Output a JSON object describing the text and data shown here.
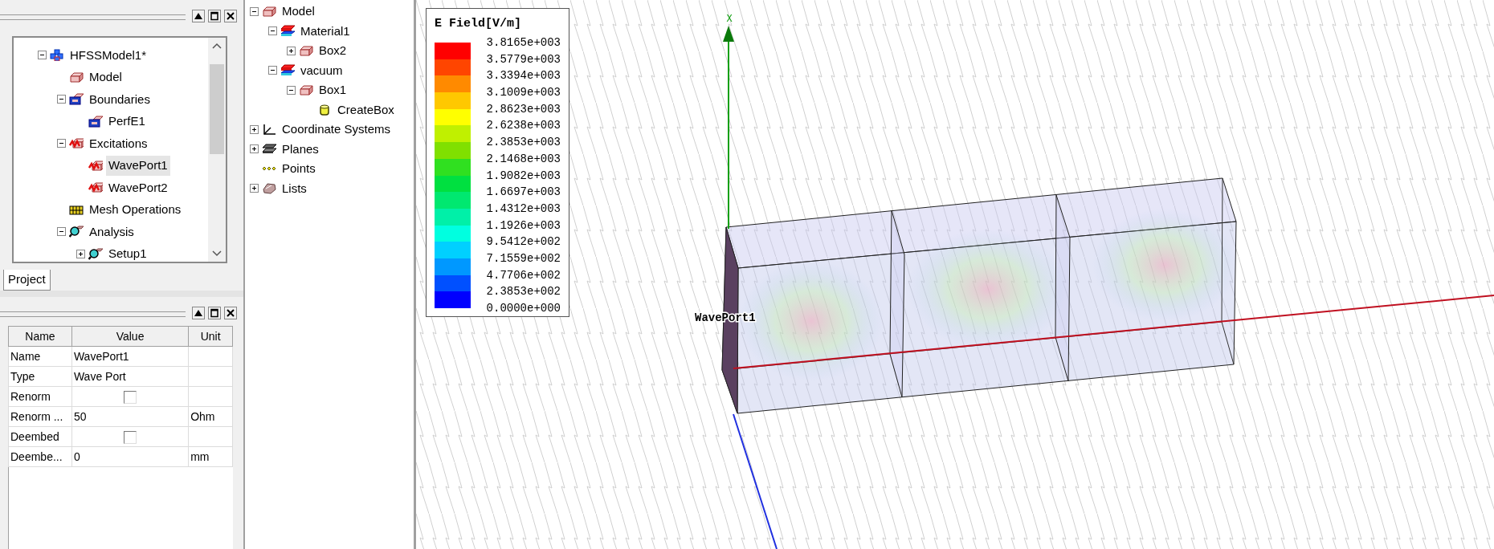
{
  "project_panel": {
    "tree": [
      {
        "label": "HFSSModel1*",
        "kind": "project",
        "expanded": true,
        "selected": false,
        "children": [
          {
            "label": "Model",
            "kind": "box",
            "selected": false
          },
          {
            "label": "Boundaries",
            "kind": "boundary",
            "expanded": true,
            "selected": false,
            "children": [
              {
                "label": "PerfE1",
                "kind": "boundary",
                "selected": false
              }
            ]
          },
          {
            "label": "Excitations",
            "kind": "excitation",
            "expanded": true,
            "selected": false,
            "children": [
              {
                "label": "WavePort1",
                "kind": "excitation",
                "selected": true
              },
              {
                "label": "WavePort2",
                "kind": "excitation",
                "selected": false
              }
            ]
          },
          {
            "label": "Mesh Operations",
            "kind": "mesh",
            "selected": false
          },
          {
            "label": "Analysis",
            "kind": "analysis",
            "expanded": true,
            "selected": false,
            "children": [
              {
                "label": "Setup1",
                "kind": "analysis",
                "expanded": false,
                "selected": false
              }
            ]
          }
        ]
      }
    ],
    "tabs": [
      {
        "label": "Project",
        "selected": true
      }
    ]
  },
  "properties_panel": {
    "columns": [
      "Name",
      "Value",
      "Unit"
    ],
    "rows": [
      {
        "kind": "text",
        "name": "Name",
        "value": "WavePort1"
      },
      {
        "kind": "text",
        "name": "Type",
        "value": "Wave Port"
      },
      {
        "kind": "checkbox",
        "name": "Renorm",
        "checked": false
      },
      {
        "kind": "text",
        "name": "Renorm ...",
        "value": "50",
        "unit": "Ohm"
      },
      {
        "kind": "checkbox",
        "name": "Deembed",
        "checked": false
      },
      {
        "kind": "text",
        "name": "Deembe...",
        "value": "0",
        "unit": "mm"
      }
    ]
  },
  "model_tree": [
    {
      "label": "Model",
      "kind": "box",
      "expanded": true,
      "selected": false,
      "children": [
        {
          "label": "Material1",
          "kind": "material",
          "expanded": true,
          "selected": false,
          "children": [
            {
              "label": "Box2",
              "kind": "box",
              "expanded": false,
              "selected": false
            }
          ]
        },
        {
          "label": "vacuum",
          "kind": "material",
          "expanded": true,
          "selected": false,
          "children": [
            {
              "label": "Box1",
              "kind": "box",
              "expanded": true,
              "selected": false,
              "children": [
                {
                  "label": "CreateBox",
                  "kind": "operation",
                  "selected": false
                }
              ]
            }
          ]
        }
      ]
    },
    {
      "label": "Coordinate Systems",
      "kind": "coords",
      "expanded": false,
      "selected": false
    },
    {
      "label": "Planes",
      "kind": "planes",
      "expanded": false,
      "selected": false
    },
    {
      "label": "Points",
      "kind": "points",
      "selected": false
    },
    {
      "label": "Lists",
      "kind": "lists",
      "expanded": false,
      "selected": false
    }
  ],
  "viewport": {
    "legend": {
      "title": "E Field[V/m]",
      "bands": [
        {
          "color": "#ff0000"
        },
        {
          "color": "#ff4500"
        },
        {
          "color": "#ff8a00"
        },
        {
          "color": "#ffc800"
        },
        {
          "color": "#ffff00"
        },
        {
          "color": "#c0f000"
        },
        {
          "color": "#80e000"
        },
        {
          "color": "#30e020"
        },
        {
          "color": "#00e040"
        },
        {
          "color": "#00e870"
        },
        {
          "color": "#00f0a8"
        },
        {
          "color": "#00ffe0"
        },
        {
          "color": "#00d0ff"
        },
        {
          "color": "#0098ff"
        },
        {
          "color": "#0050ff"
        },
        {
          "color": "#0000ff"
        }
      ],
      "labels": [
        "3.8165e+003",
        "3.5779e+003",
        "3.3394e+003",
        "3.1009e+003",
        "2.8623e+003",
        "2.6238e+003",
        "2.3853e+003",
        "2.1468e+003",
        "1.9082e+003",
        "1.6697e+003",
        "1.4312e+003",
        "1.1926e+003",
        "9.5412e+002",
        "7.1559e+002",
        "4.7706e+002",
        "2.3853e+002",
        "0.0000e+000"
      ]
    },
    "axis_label": "X",
    "port_label": "WavePort1"
  }
}
